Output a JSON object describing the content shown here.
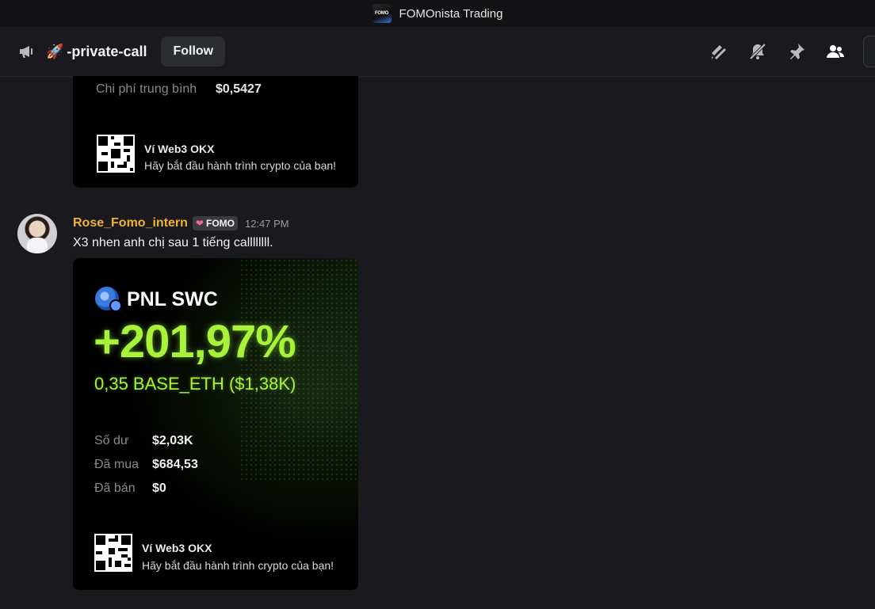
{
  "window": {
    "title": "FOMOnista Trading",
    "logo_text": "FOMO"
  },
  "channel": {
    "emoji": "🚀",
    "name": "-private-call",
    "follow_label": "Follow"
  },
  "header_tools": [
    "threads-icon",
    "mute-bell-icon",
    "pin-icon",
    "members-icon"
  ],
  "prev_card": {
    "avg_label": "Chi phí trung bình",
    "avg_value": "$0,5427",
    "wallet_title": "Ví Web3 OKX",
    "wallet_sub": "Hãy bắt đầu hành trình crypto của bạn!"
  },
  "message": {
    "username": "Rose_Fomo_intern",
    "role_tag": "FOMO",
    "timestamp": "12:47 PM",
    "text": "X3 nhen anh chị sau 1 tiếng callllllll."
  },
  "pnl_card": {
    "title": "PNL SWC",
    "percent": "+201,97%",
    "base": "0,35 BASE_ETH ($1,38K)",
    "rows": [
      {
        "label": "Số dư",
        "value": "$2,03K"
      },
      {
        "label": "Đã mua",
        "value": "$684,53"
      },
      {
        "label": "Đã bán",
        "value": "$0"
      }
    ],
    "wallet_title": "Ví Web3 OKX",
    "wallet_sub": "Hãy bắt đầu hành trình crypto của bạn!"
  },
  "colors": {
    "accent_green": "#a8f23a",
    "username": "#f0b232",
    "background": "#1a1a1e"
  }
}
